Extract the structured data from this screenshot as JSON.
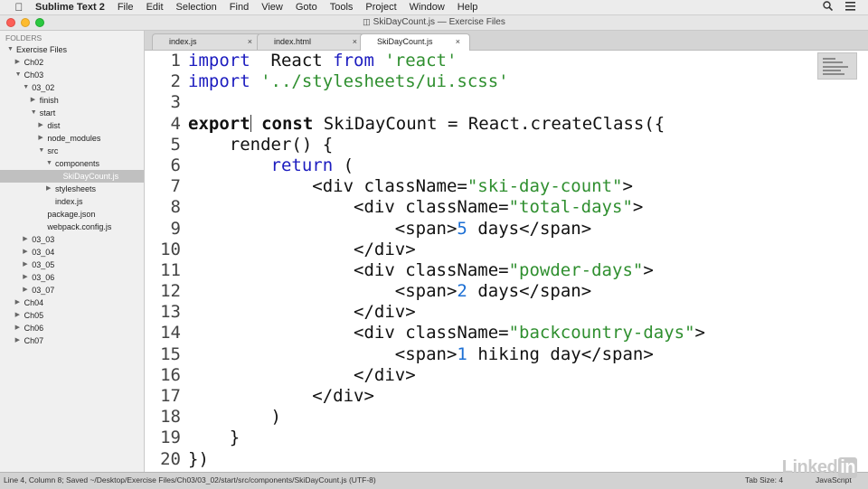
{
  "menubar": {
    "app": "Sublime Text 2",
    "items": [
      "File",
      "Edit",
      "Selection",
      "Find",
      "View",
      "Goto",
      "Tools",
      "Project",
      "Window",
      "Help"
    ],
    "right_icons": [
      "search-icon",
      "list-icon"
    ]
  },
  "window": {
    "title": "SkiDayCount.js — Exercise Files"
  },
  "sidebar": {
    "heading": "FOLDERS",
    "items": [
      {
        "label": "Exercise Files",
        "depth": 0,
        "expanded": true,
        "arrow": true
      },
      {
        "label": "Ch02",
        "depth": 1,
        "expanded": false,
        "arrow": true
      },
      {
        "label": "Ch03",
        "depth": 1,
        "expanded": true,
        "arrow": true
      },
      {
        "label": "03_02",
        "depth": 2,
        "expanded": true,
        "arrow": true
      },
      {
        "label": "finish",
        "depth": 3,
        "expanded": false,
        "arrow": true
      },
      {
        "label": "start",
        "depth": 3,
        "expanded": true,
        "arrow": true
      },
      {
        "label": "dist",
        "depth": 4,
        "expanded": false,
        "arrow": true
      },
      {
        "label": "node_modules",
        "depth": 4,
        "expanded": false,
        "arrow": true
      },
      {
        "label": "src",
        "depth": 4,
        "expanded": true,
        "arrow": true
      },
      {
        "label": "components",
        "depth": 5,
        "expanded": true,
        "arrow": true
      },
      {
        "label": "SkiDayCount.js",
        "depth": 6,
        "arrow": false,
        "selected": true
      },
      {
        "label": "stylesheets",
        "depth": 5,
        "expanded": false,
        "arrow": true
      },
      {
        "label": "index.js",
        "depth": 5,
        "arrow": false
      },
      {
        "label": "package.json",
        "depth": 4,
        "arrow": false
      },
      {
        "label": "webpack.config.js",
        "depth": 4,
        "arrow": false
      },
      {
        "label": "03_03",
        "depth": 2,
        "expanded": false,
        "arrow": true
      },
      {
        "label": "03_04",
        "depth": 2,
        "expanded": false,
        "arrow": true
      },
      {
        "label": "03_05",
        "depth": 2,
        "expanded": false,
        "arrow": true
      },
      {
        "label": "03_06",
        "depth": 2,
        "expanded": false,
        "arrow": true
      },
      {
        "label": "03_07",
        "depth": 2,
        "expanded": false,
        "arrow": true
      },
      {
        "label": "Ch04",
        "depth": 1,
        "expanded": false,
        "arrow": true
      },
      {
        "label": "Ch05",
        "depth": 1,
        "expanded": false,
        "arrow": true
      },
      {
        "label": "Ch06",
        "depth": 1,
        "expanded": false,
        "arrow": true
      },
      {
        "label": "Ch07",
        "depth": 1,
        "expanded": false,
        "arrow": true
      }
    ]
  },
  "tabs": [
    {
      "label": "index.js",
      "close": "×",
      "active": false
    },
    {
      "label": "index.html",
      "close": "×",
      "active": false
    },
    {
      "label": "SkiDayCount.js",
      "close": "×",
      "active": true
    }
  ],
  "editor": {
    "lines": [
      [
        [
          "kw",
          "import"
        ],
        [
          "",
          "  React "
        ],
        [
          "kw",
          "from"
        ],
        [
          "",
          ""
        ],
        [
          "str",
          " 'react'"
        ]
      ],
      [
        [
          "kw",
          "import"
        ],
        [
          "str",
          " '../stylesheets/ui.scss'"
        ]
      ],
      [],
      [
        [
          "bold",
          "export"
        ],
        [
          "",
          ""
        ],
        [
          "caret",
          ""
        ],
        [
          "bold",
          " const"
        ],
        [
          "",
          ""
        ],
        [
          "",
          ""
        ],
        [
          "",
          " SkiDayCount = React.createClass({"
        ]
      ],
      [
        [
          "",
          "    render() {"
        ]
      ],
      [
        [
          "",
          "        "
        ],
        [
          "kw",
          "return"
        ],
        [
          "",
          " ("
        ]
      ],
      [
        [
          "",
          "            <div className="
        ],
        [
          "str",
          "\"ski-day-count\""
        ],
        [
          "",
          ">"
        ]
      ],
      [
        [
          "",
          "                <div className="
        ],
        [
          "str",
          "\"total-days\""
        ],
        [
          "",
          ">"
        ]
      ],
      [
        [
          "",
          "                    <span>"
        ],
        [
          "num",
          "5"
        ],
        [
          "",
          " days</span>"
        ]
      ],
      [
        [
          "",
          "                </div>"
        ]
      ],
      [
        [
          "",
          "                <div className="
        ],
        [
          "str",
          "\"powder-days\""
        ],
        [
          "",
          ">"
        ]
      ],
      [
        [
          "",
          "                    <span>"
        ],
        [
          "num",
          "2"
        ],
        [
          "",
          " days</span>"
        ]
      ],
      [
        [
          "",
          "                </div>"
        ]
      ],
      [
        [
          "",
          "                <div className="
        ],
        [
          "str",
          "\"backcountry-days\""
        ],
        [
          "",
          ">"
        ]
      ],
      [
        [
          "",
          "                    <span>"
        ],
        [
          "num",
          "1"
        ],
        [
          "",
          " hiking day</span>"
        ]
      ],
      [
        [
          "",
          "                </div>"
        ]
      ],
      [
        [
          "",
          "            </div>"
        ]
      ],
      [
        [
          "",
          "        )"
        ]
      ],
      [
        [
          "",
          "    }"
        ]
      ],
      [
        [
          "",
          "})"
        ]
      ]
    ]
  },
  "statusbar": {
    "left": "Line 4, Column 8; Saved ~/Desktop/Exercise Files/Ch03/03_02/start/src/components/SkiDayCount.js (UTF-8)",
    "tab_size": "Tab Size: 4",
    "syntax": "JavaScript"
  },
  "watermark": {
    "text": "Linked",
    "suffix": "in"
  }
}
